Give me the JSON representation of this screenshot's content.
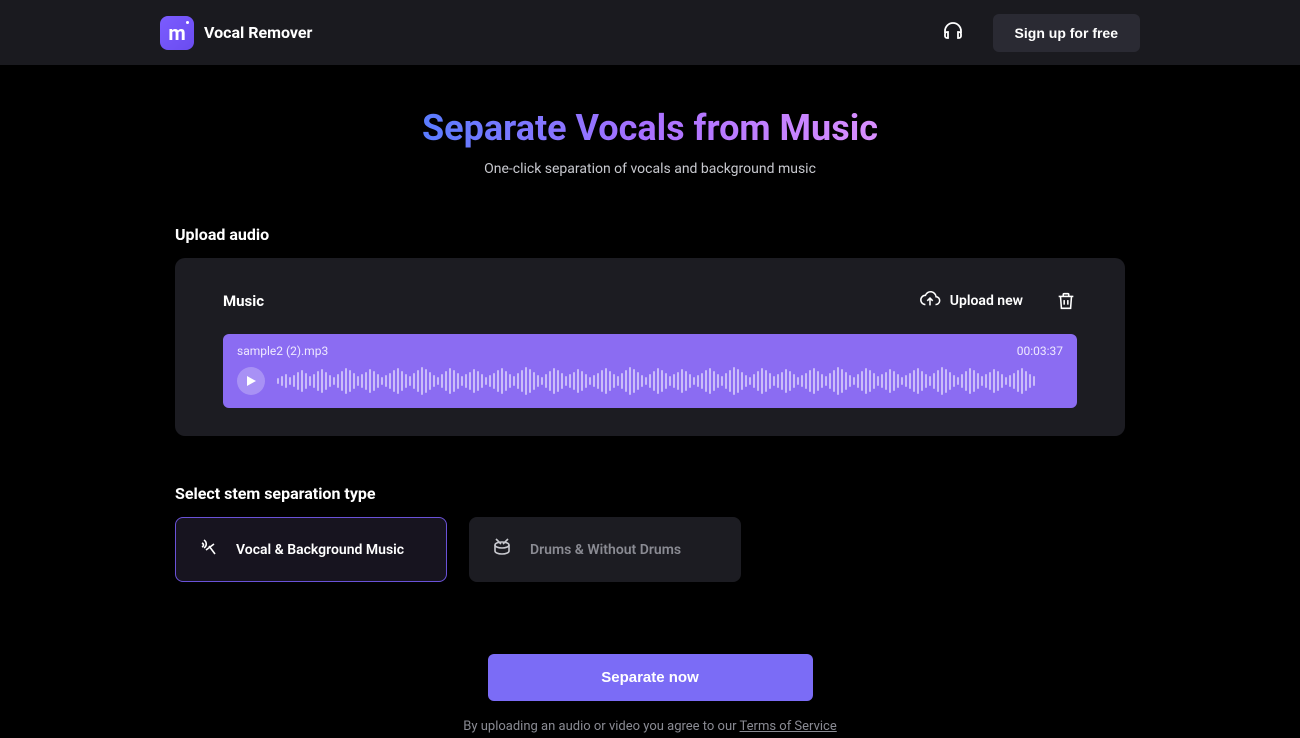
{
  "header": {
    "app_name": "Vocal Remover",
    "signup_label": "Sign up for free"
  },
  "hero": {
    "title": "Separate Vocals from Music",
    "subtitle": "One-click separation of vocals and background music"
  },
  "upload": {
    "section_label": "Upload audio",
    "music_label": "Music",
    "upload_new_label": "Upload new",
    "track": {
      "filename": "sample2 (2).mp3",
      "duration": "00:03:37"
    }
  },
  "stems": {
    "section_label": "Select stem separation type",
    "options": [
      {
        "label": "Vocal & Background Music",
        "selected": true
      },
      {
        "label": "Drums & Without Drums",
        "selected": false
      }
    ]
  },
  "actions": {
    "separate_label": "Separate now"
  },
  "legal": {
    "prefix": "By uploading an audio or video you agree to our ",
    "link_label": "Terms of Service"
  }
}
